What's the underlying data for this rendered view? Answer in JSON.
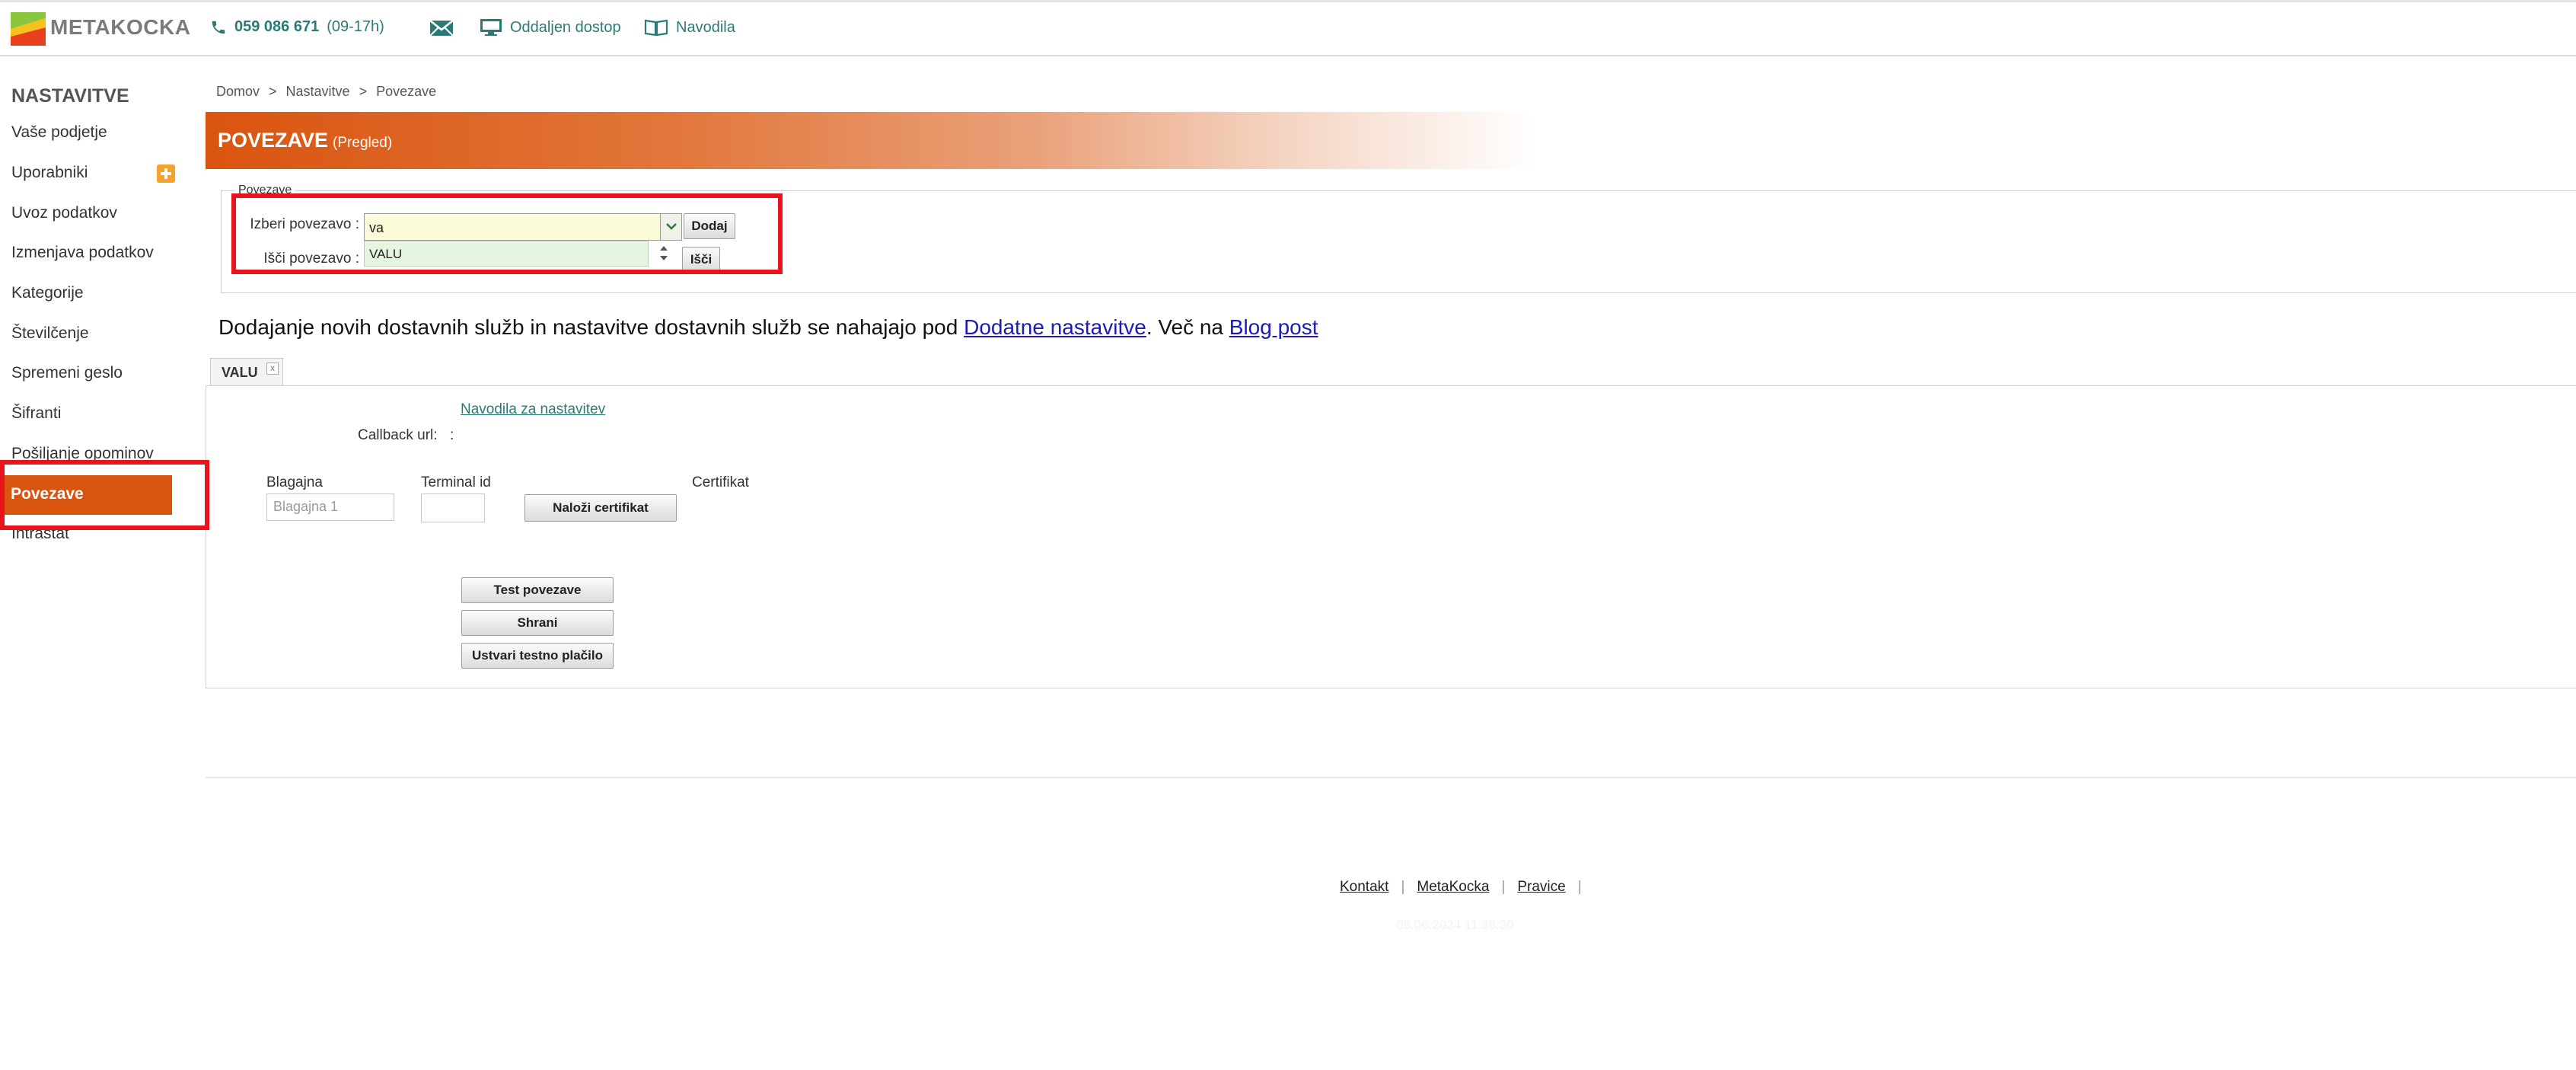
{
  "topbar": {
    "logo_text": "METAKOCKA",
    "phone_number": "059 086 671",
    "phone_hours": "(09-17h)",
    "remote_access": "Oddaljen dostop",
    "manual": "Navodila",
    "icons": [
      "phone-icon",
      "mail-icon",
      "monitor-icon",
      "book-icon"
    ]
  },
  "sidebar": {
    "title": "NASTAVITVE",
    "items": [
      {
        "label": "Vaše podjetje"
      },
      {
        "label": "Uporabniki"
      },
      {
        "label": "Uvoz podatkov"
      },
      {
        "label": "Izmenjava podatkov"
      },
      {
        "label": "Kategorije"
      },
      {
        "label": "Številčenje"
      },
      {
        "label": "Spremeni geslo"
      },
      {
        "label": "Šifranti"
      },
      {
        "label": "Pošiljanje opominov"
      },
      {
        "label": "Povezave",
        "active": true
      },
      {
        "label": "Intrastat"
      }
    ]
  },
  "breadcrumb": [
    "Domov",
    "Nastavitve",
    "Povezave"
  ],
  "header": {
    "title": "POVEZAVE",
    "subtitle": "(Pregled)"
  },
  "connections_form": {
    "legend": "Povezave",
    "select_label": "Izberi povezavo :",
    "select_value": "va",
    "dropdown_option": "VALU",
    "add_button": "Dodaj",
    "search_label": "Išči povezavo :",
    "search_button": "Išči"
  },
  "info": {
    "text": "Dodajanje novih dostavnih služb in nastavitve dostavnih služb se nahajajo pod ",
    "link1": "Dodatne nastavitve",
    "middle": ". Več na ",
    "link2": "Blog post"
  },
  "tab": {
    "label": "VALU",
    "close": "x"
  },
  "settings": {
    "instructions_link": "Navodila za nastavitev",
    "callback_label": "Callback url:",
    "callback_value": ":",
    "cash_register_label": "Blagajna",
    "cash_register_placeholder": "Blagajna 1",
    "terminal_label": "Terminal id",
    "terminal_value": "",
    "certificate_label": "Certifikat",
    "upload_certificate_button": "Naloži certifikat",
    "test_button": "Test povezave",
    "save_button": "Shrani",
    "test_payment_button": "Ustvari testno plačilo"
  },
  "footer": {
    "links": [
      "Kontakt",
      "MetaKocka",
      "Pravice"
    ],
    "separator": "|",
    "timestamp": "05.06.2024 11:36:30"
  },
  "colors": {
    "accent": "#d9540f",
    "teal": "#2b7a78",
    "highlight": "#e8141b"
  }
}
